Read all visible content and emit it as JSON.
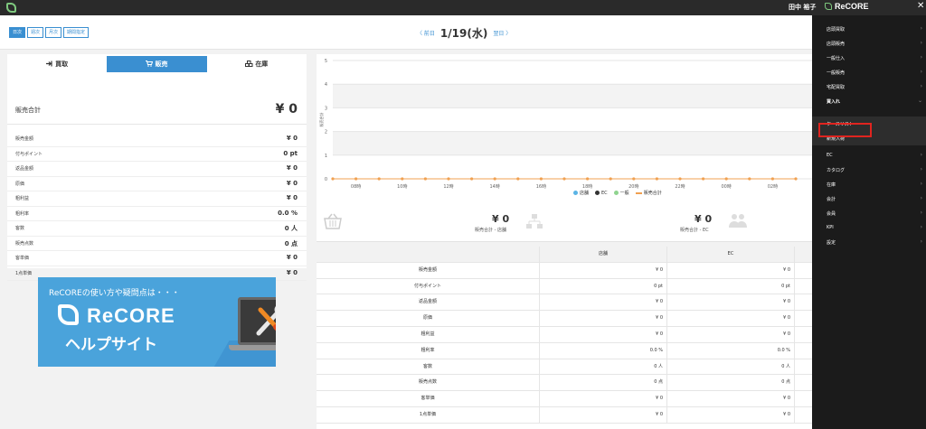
{
  "topbar": {
    "user_name": "田中 裕子",
    "brand": "ReCORE",
    "close": "✕"
  },
  "range_buttons": [
    "日次",
    "週次",
    "月次",
    "期間指定"
  ],
  "date_nav": {
    "prev": "〈 前日",
    "date": "1/19(水)",
    "next": "翌日 〉"
  },
  "tabs": [
    {
      "label": "買取",
      "icon": "arrow-in-icon"
    },
    {
      "label": "販売",
      "icon": "cart-icon"
    },
    {
      "label": "在庫",
      "icon": "boxes-icon"
    }
  ],
  "total": {
    "label": "販売合計",
    "value": "¥ 0"
  },
  "metrics": [
    {
      "label": "販売金額",
      "value": "¥ 0"
    },
    {
      "label": "付与ポイント",
      "value": "0 pt"
    },
    {
      "label": "返品金額",
      "value": "¥ 0"
    },
    {
      "label": "原価",
      "value": "¥ 0"
    },
    {
      "label": "粗利益",
      "value": "¥ 0"
    },
    {
      "label": "粗利率",
      "value": "0.0 %"
    },
    {
      "label": "客数",
      "value": "0 人"
    },
    {
      "label": "販売点数",
      "value": "0 点"
    },
    {
      "label": "客単価",
      "value": "¥ 0"
    },
    {
      "label": "1点単価",
      "value": "¥ 0"
    }
  ],
  "banner": {
    "top_text": "ReCOREの使い方や疑問点は・・・",
    "name": "ReCORE",
    "sub": "ヘルプサイト"
  },
  "chart_data": {
    "type": "line",
    "x": [
      "08時",
      "10時",
      "12時",
      "14時",
      "16時",
      "18時",
      "20時",
      "22時",
      "00時",
      "02時"
    ],
    "ylabel": "販売合計",
    "ylim": [
      0,
      5
    ],
    "yticks": [
      "0",
      "1",
      "2",
      "3",
      "4",
      "5"
    ],
    "grid": true,
    "series": [
      {
        "name": "店舗",
        "color": "#5bb4e5",
        "values": [
          0,
          0,
          0,
          0,
          0,
          0,
          0,
          0,
          0,
          0
        ]
      },
      {
        "name": "EC",
        "color": "#333333",
        "values": [
          0,
          0,
          0,
          0,
          0,
          0,
          0,
          0,
          0,
          0
        ]
      },
      {
        "name": "一般",
        "color": "#8fd48f",
        "values": [
          0,
          0,
          0,
          0,
          0,
          0,
          0,
          0,
          0,
          0
        ]
      },
      {
        "name": "販売合計",
        "color": "#f0a050",
        "values": [
          0,
          0,
          0,
          0,
          0,
          0,
          0,
          0,
          0,
          0
        ]
      }
    ],
    "legend_position": "bottom"
  },
  "summary": [
    {
      "value": "¥ 0",
      "label": "販売合計 - 店舗",
      "icon": "basket-icon"
    },
    {
      "value": "¥ 0",
      "label": "販売合計 - EC",
      "icon": "network-icon"
    }
  ],
  "summary_extra_icon": "people-icon",
  "table": {
    "headers": [
      "",
      "店舗",
      "EC"
    ],
    "rows": [
      [
        "販売金額",
        "¥ 0",
        "¥ 0"
      ],
      [
        "付与ポイント",
        "0 pt",
        "0 pt"
      ],
      [
        "返品金額",
        "¥ 0",
        "¥ 0"
      ],
      [
        "原価",
        "¥ 0",
        "¥ 0"
      ],
      [
        "粗利益",
        "¥ 0",
        "¥ 0"
      ],
      [
        "粗利率",
        "0.0 %",
        "0.0 %"
      ],
      [
        "客数",
        "0 人",
        "0 人"
      ],
      [
        "販売点数",
        "0 点",
        "0 点"
      ],
      [
        "客単価",
        "¥ 0",
        "¥ 0"
      ],
      [
        "1点単価",
        "¥ 0",
        "¥ 0"
      ]
    ]
  },
  "sidebar": {
    "items": [
      {
        "label": "店頭買取",
        "chev": "›"
      },
      {
        "label": "店頭販売",
        "chev": "›"
      },
      {
        "label": "一般仕入",
        "chev": "›"
      },
      {
        "label": "一般販売",
        "chev": "›"
      },
      {
        "label": "宅配買取",
        "chev": "›"
      },
      {
        "label": "買入れ",
        "chev": "⌄"
      }
    ],
    "sub_items": [
      "ケースリスト",
      "新規入荷"
    ],
    "items2": [
      {
        "label": "EC",
        "chev": "›"
      },
      {
        "label": "カタログ",
        "chev": "›"
      },
      {
        "label": "在庫",
        "chev": "›"
      },
      {
        "label": "会計",
        "chev": "›"
      },
      {
        "label": "会員",
        "chev": "›"
      },
      {
        "label": "KPI",
        "chev": "›"
      },
      {
        "label": "設定",
        "chev": "›"
      }
    ]
  },
  "colors": {
    "accent": "#3a8fd1",
    "sidebar": "#1b1b1b",
    "highlight": "#e0241f"
  }
}
